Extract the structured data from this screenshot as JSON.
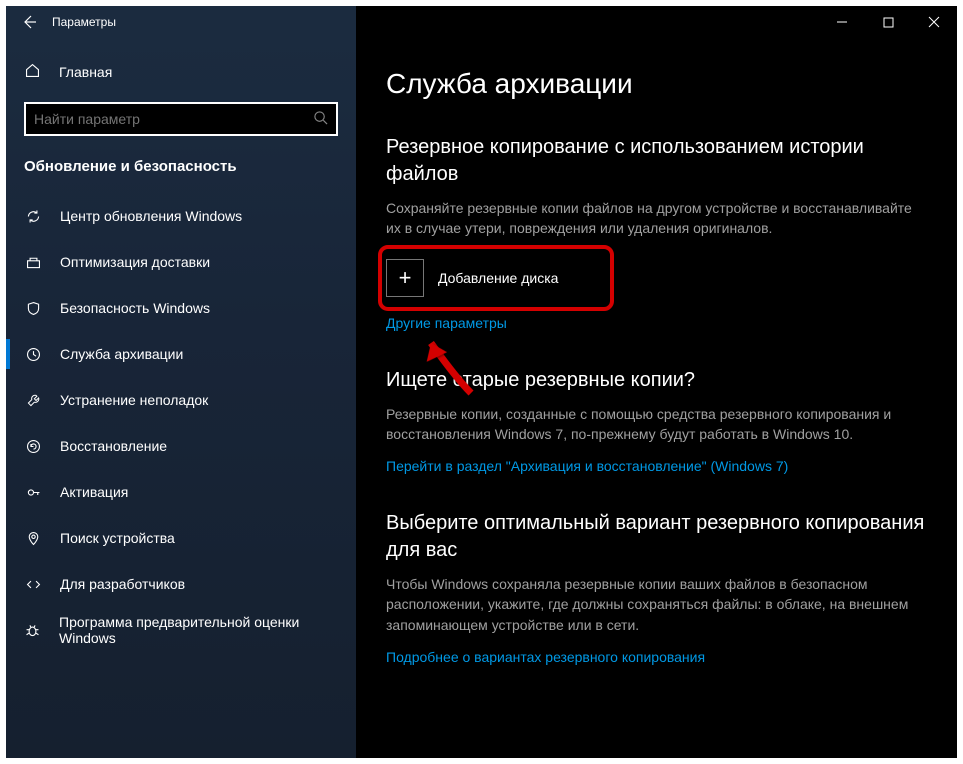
{
  "titlebar": {
    "title": "Параметры"
  },
  "sidebar": {
    "home": "Главная",
    "search_placeholder": "Найти параметр",
    "section": "Обновление и безопасность",
    "items": [
      {
        "id": "windows-update",
        "label": "Центр обновления Windows"
      },
      {
        "id": "delivery-opt",
        "label": "Оптимизация доставки"
      },
      {
        "id": "windows-security",
        "label": "Безопасность Windows"
      },
      {
        "id": "backup",
        "label": "Служба архивации",
        "active": true
      },
      {
        "id": "troubleshoot",
        "label": "Устранение неполадок"
      },
      {
        "id": "recovery",
        "label": "Восстановление"
      },
      {
        "id": "activation",
        "label": "Активация"
      },
      {
        "id": "find-device",
        "label": "Поиск устройства"
      },
      {
        "id": "for-developers",
        "label": "Для разработчиков"
      },
      {
        "id": "insider",
        "label": "Программа предварительной оценки Windows"
      }
    ]
  },
  "content": {
    "page_title": "Служба архивации",
    "section1": {
      "heading": "Резервное копирование с использованием истории файлов",
      "desc": "Сохраняйте резервные копии файлов на другом устройстве и восстанавливайте их в случае утери, повреждения или удаления оригиналов.",
      "add_drive": "Добавление диска",
      "more_options": "Другие параметры"
    },
    "section2": {
      "heading": "Ищете старые резервные копии?",
      "desc": "Резервные копии, созданные с помощью средства резервного копирования и восстановления Windows 7, по-прежнему будут работать в Windows 10.",
      "link": "Перейти в раздел \"Архивация и восстановление\" (Windows 7)"
    },
    "section3": {
      "heading": "Выберите оптимальный вариант резервного копирования для вас",
      "desc": "Чтобы Windows сохраняла резервные копии ваших файлов в безопасном расположении, укажите, где должны сохраняться файлы: в облаке, на внешнем запоминающем устройстве или в сети.",
      "link": "Подробнее о вариантах резервного копирования"
    }
  }
}
